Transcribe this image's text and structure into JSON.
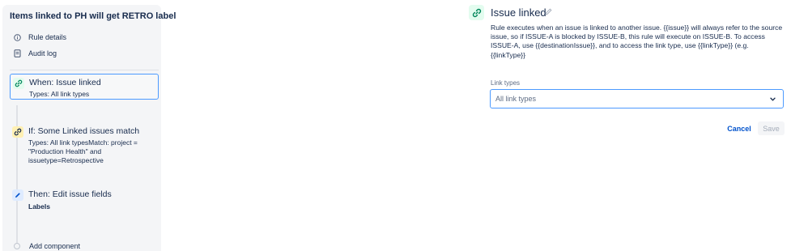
{
  "rule": {
    "title": "Items linked to PH will get RETRO label",
    "menu": [
      {
        "label": "Rule details",
        "icon": "info-icon"
      },
      {
        "label": "Audit log",
        "icon": "document-icon"
      }
    ],
    "steps": [
      {
        "title": "When: Issue linked",
        "desc": "Types: All link types",
        "icon": "link-icon",
        "color": "#00875a"
      },
      {
        "title": "If: Some Linked issues match",
        "desc": "Types: All link typesMatch: project = \"Production Health\" and issuetype=Retrospective",
        "icon": "link-icon",
        "color": "#ff991f"
      },
      {
        "title": "Then: Edit issue fields",
        "desc": "Labels",
        "icon": "pencil-icon",
        "color": "#0052cc"
      }
    ],
    "add_component": "Add component"
  },
  "detail": {
    "title": "Issue linked",
    "description": "Rule executes when an issue is linked to another issue. {{issue}} will always refer to the source issue, so if ISSUE-A is blocked by ISSUE-B, this rule will execute on ISSUE-B. To access ISSUE-A, use {{destinationIssue}}, and to access the link type, use {{linkType}} (e.g. {{linkType}}",
    "field_label": "Link types",
    "field_value": "All link types",
    "cancel_label": "Cancel",
    "save_label": "Save"
  },
  "colors": {
    "accent": "#0052cc",
    "selected_border": "#4c9aff",
    "panel_bg": "#f4f5f7"
  }
}
